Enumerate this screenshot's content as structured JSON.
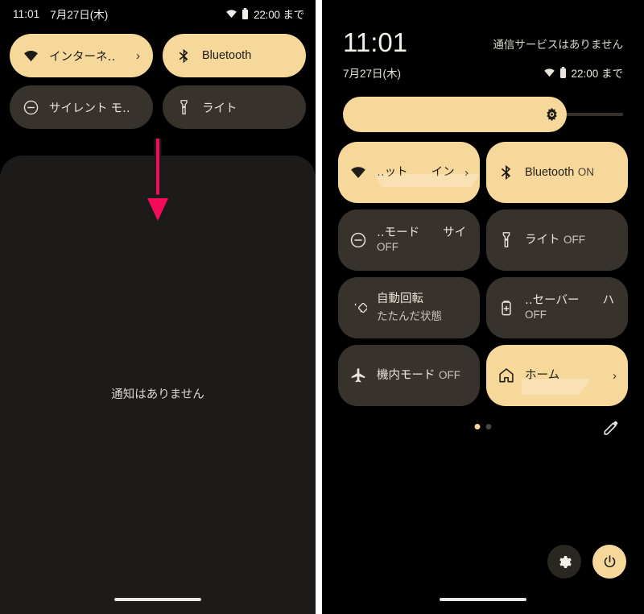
{
  "left_panel": {
    "status_bar": {
      "time": "11:01",
      "date": "7月27日(木)",
      "wifi_icon": "wifi-icon",
      "battery_icon": "battery-icon",
      "battery_text": "22:00 まで"
    },
    "quick_tiles": [
      {
        "label": "インターネ‥",
        "state": "on",
        "icon": "wifi-icon",
        "chevron": "›"
      },
      {
        "label": "Bluetooth",
        "state": "on",
        "icon": "bluetooth-icon",
        "chevron": ""
      },
      {
        "label": "サイレント モ‥",
        "state": "off",
        "icon": "do-not-disturb-icon",
        "chevron": ""
      },
      {
        "label": "ライト",
        "state": "off",
        "icon": "flashlight-icon",
        "chevron": ""
      }
    ],
    "shade": {
      "empty_text": "通知はありません"
    },
    "annotation": {
      "arrow_direction": "down",
      "arrow_color": "#f50a5c"
    }
  },
  "right_panel": {
    "header": {
      "clock": "11:01",
      "carrier": "通信サービスはありません",
      "date": "7月27日(木)",
      "wifi_icon": "wifi-icon",
      "battery_icon": "battery-icon",
      "battery_text": "22:00 まで"
    },
    "brightness": {
      "label": "brightness-slider",
      "icon": "brightness-icon",
      "value_percent": 80
    },
    "tiles": [
      {
        "title": "‥ット　　イン",
        "subtitle": "",
        "state": "on",
        "icon": "wifi-icon",
        "chevron": "›",
        "redacted": "wifi"
      },
      {
        "title": "Bluetooth",
        "subtitle": "ON",
        "state": "on",
        "icon": "bluetooth-icon",
        "chevron": "",
        "redacted": ""
      },
      {
        "title": "‥モード　　サイ",
        "subtitle": "OFF",
        "state": "off",
        "icon": "do-not-disturb-icon",
        "chevron": "",
        "redacted": ""
      },
      {
        "title": "ライト",
        "subtitle": "OFF",
        "state": "off",
        "icon": "flashlight-icon",
        "chevron": "",
        "redacted": ""
      },
      {
        "title": "自動回転",
        "subtitle": "たたんだ状態",
        "state": "off",
        "icon": "auto-rotate-icon",
        "chevron": "",
        "redacted": ""
      },
      {
        "title": "‥セーバー　　ハ",
        "subtitle": "OFF",
        "state": "off",
        "icon": "battery-saver-icon",
        "chevron": "",
        "redacted": ""
      },
      {
        "title": "機内モード",
        "subtitle": "OFF",
        "state": "off",
        "icon": "airplane-icon",
        "chevron": "",
        "redacted": ""
      },
      {
        "title": "ホーム",
        "subtitle": "",
        "state": "on",
        "icon": "home-icon",
        "chevron": "›",
        "redacted": "home"
      }
    ],
    "footer": {
      "pages": 2,
      "active_page": 1,
      "edit_icon": "pencil-icon"
    },
    "actions": [
      {
        "name": "settings-button",
        "icon": "gear-icon",
        "style": "dark"
      },
      {
        "name": "power-button",
        "icon": "power-icon",
        "style": "accent"
      }
    ]
  },
  "colors": {
    "accent": "#f7d89b",
    "tile_off": "#37332c",
    "shade_bg": "#1c1b19",
    "background": "#000000",
    "arrow": "#f50a5c"
  }
}
